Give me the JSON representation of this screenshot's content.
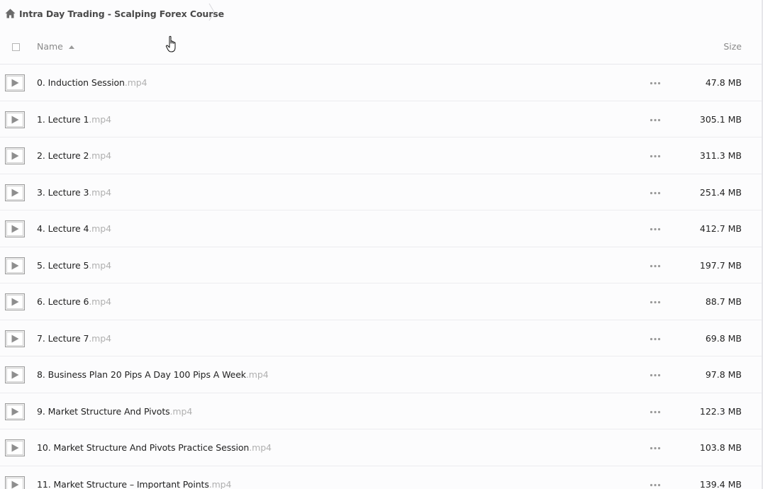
{
  "breadcrumb": {
    "title": "Intra Day Trading - Scalping Forex Course"
  },
  "header": {
    "name_label": "Name",
    "size_label": "Size"
  },
  "files": [
    {
      "name": "0. Induction Session",
      "ext": ".mp4",
      "size": "47.8 MB"
    },
    {
      "name": "1. Lecture 1",
      "ext": ".mp4",
      "size": "305.1 MB"
    },
    {
      "name": "2. Lecture 2",
      "ext": ".mp4",
      "size": "311.3 MB"
    },
    {
      "name": "3. Lecture 3",
      "ext": ".mp4",
      "size": "251.4 MB"
    },
    {
      "name": "4. Lecture 4",
      "ext": ".mp4",
      "size": "412.7 MB"
    },
    {
      "name": "5. Lecture 5",
      "ext": ".mp4",
      "size": "197.7 MB"
    },
    {
      "name": "6. Lecture 6",
      "ext": ".mp4",
      "size": "88.7 MB"
    },
    {
      "name": "7. Lecture 7",
      "ext": ".mp4",
      "size": "69.8 MB"
    },
    {
      "name": "8. Business Plan 20 Pips A Day 100 Pips A Week",
      "ext": ".mp4",
      "size": "97.8 MB"
    },
    {
      "name": "9. Market Structure And Pivots",
      "ext": ".mp4",
      "size": "122.3 MB"
    },
    {
      "name": "10. Market Structure And Pivots Practice Session",
      "ext": ".mp4",
      "size": "103.8 MB"
    },
    {
      "name": "11. Market Structure – Important Points",
      "ext": ".mp4",
      "size": "139.4 MB"
    }
  ],
  "icons": {
    "home": "home-icon",
    "play": "play-icon",
    "more": "more-options-icon",
    "cursor": "hand-cursor-icon"
  },
  "colors": {
    "background": "#fcfcfd",
    "text": "#222222",
    "muted": "#8a8a8a",
    "ext": "#b0b0b0"
  }
}
